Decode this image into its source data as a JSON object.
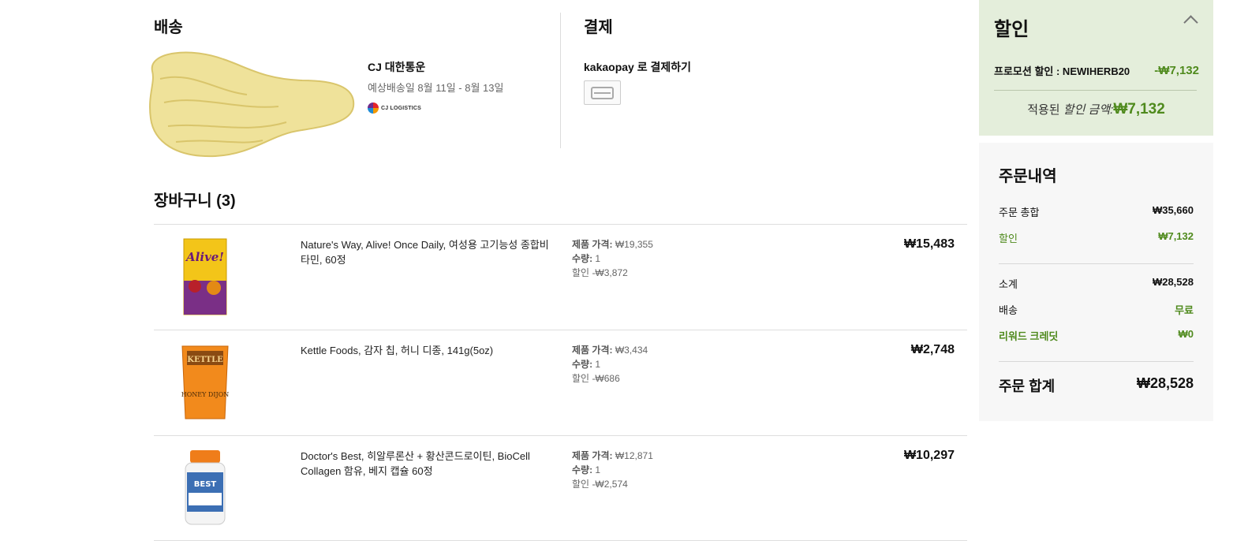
{
  "shipping": {
    "title": "배송",
    "carrier_name": "CJ 대한통운",
    "eta": "예상배송일 8월 11일 - 8월 13일",
    "carrier_logo_text": "CJ LOGISTICS"
  },
  "payment": {
    "title": "결제",
    "method_label": "kakaopay 로 결제하기",
    "icon": "credit-card-icon"
  },
  "cart": {
    "title": "장바구니 (3)",
    "items": [
      {
        "name": "Nature's Way, Alive! Once Daily, 여성용 고기능성 종합비타민, 60정",
        "price_label": "제품 가격:",
        "price": "₩19,355",
        "qty_label": "수량:",
        "qty": "1",
        "discount_label": "할인",
        "discount": "-₩3,872",
        "total": "₩15,483",
        "thumb_text": "Alive!"
      },
      {
        "name": "Kettle Foods, 감자 칩, 허니 디종, 141g(5oz)",
        "price_label": "제품 가격:",
        "price": "₩3,434",
        "qty_label": "수량:",
        "qty": "1",
        "discount_label": "할인",
        "discount": "-₩686",
        "total": "₩2,748",
        "thumb_text": "HONEY DIJON"
      },
      {
        "name": "Doctor's Best, 히알루론산 + 황산콘드로이틴, BioCell Collagen 함유, 베지 캡슐 60정",
        "price_label": "제품 가격:",
        "price": "₩12,871",
        "qty_label": "수량:",
        "qty": "1",
        "discount_label": "할인",
        "discount": "-₩2,574",
        "total": "₩10,297",
        "thumb_text": "BEST"
      }
    ]
  },
  "discount": {
    "title": "할인",
    "promo_label": "프로모션 할인 : NEWIHERB20",
    "promo_value": "-₩7,132",
    "applied_prefix": "적용된",
    "applied_italic": "할인 금액:",
    "applied_amount": "₩7,132"
  },
  "summary": {
    "title": "주문내역",
    "order_total_label": "주문 총합",
    "order_total": "₩35,660",
    "discount_label": "할인",
    "discount": "₩7,132",
    "subtotal_label": "소계",
    "subtotal": "₩28,528",
    "shipping_label": "배송",
    "shipping": "무료",
    "reward_label": "리워드 크레딧",
    "reward": "₩0",
    "grand_total_label": "주문 합계",
    "grand_total": "₩28,528"
  },
  "colors": {
    "accent_green": "#4f8a1d",
    "discount_bg": "#e4eedb",
    "summary_bg": "#f7f7f7"
  }
}
